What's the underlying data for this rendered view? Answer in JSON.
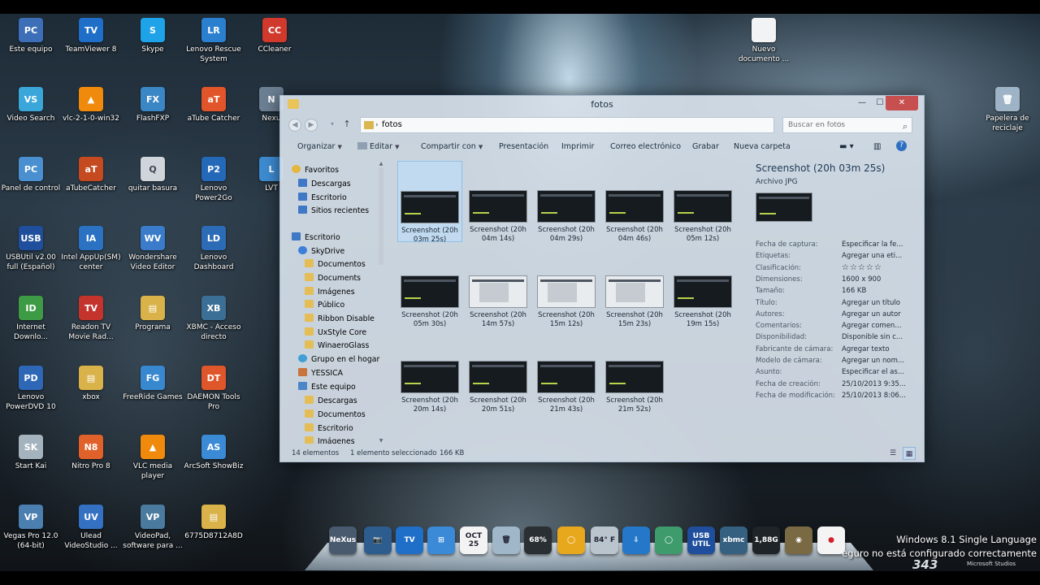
{
  "desktop": {
    "icons": [
      {
        "label": "Este equipo",
        "glyph": "PC",
        "color": "#3d6fb8"
      },
      {
        "label": "TeamViewer 8",
        "glyph": "TV",
        "color": "#1f6fc9"
      },
      {
        "label": "Skype",
        "glyph": "S",
        "color": "#1fa3e8"
      },
      {
        "label": "Lenovo Rescue System",
        "glyph": "LR",
        "color": "#2a7fcf"
      },
      {
        "label": "CCleaner",
        "glyph": "CC",
        "color": "#d0392b"
      },
      {
        "label": "Video Search",
        "glyph": "VS",
        "color": "#3aa6d9"
      },
      {
        "label": "vlc-2-1-0-win32",
        "glyph": "▲",
        "color": "#f08a0c"
      },
      {
        "label": "FlashFXP",
        "glyph": "FX",
        "color": "#3b86c4"
      },
      {
        "label": "aTube Catcher",
        "glyph": "aT",
        "color": "#e2552a"
      },
      {
        "label": "Nexu",
        "glyph": "N",
        "color": "#6c7f93"
      },
      {
        "label": "Panel de control",
        "glyph": "PC",
        "color": "#4a8fd0"
      },
      {
        "label": "aTubeCatcher",
        "glyph": "aT",
        "color": "#c54a1f"
      },
      {
        "label": "quitar basura",
        "glyph": "Q",
        "color": "#cfd5da"
      },
      {
        "label": "Lenovo Power2Go",
        "glyph": "P2",
        "color": "#2468b8"
      },
      {
        "label": "LVT",
        "glyph": "L",
        "color": "#3d8bd0"
      },
      {
        "label": "USBUtil v2.00 full (Español)",
        "glyph": "USB",
        "color": "#1f4f9c"
      },
      {
        "label": "Intel AppUp(SM) center",
        "glyph": "IA",
        "color": "#2b72c2"
      },
      {
        "label": "Wondershare Video Editor",
        "glyph": "WV",
        "color": "#3a7cc9"
      },
      {
        "label": "Lenovo Dashboard",
        "glyph": "LD",
        "color": "#2c6cb6"
      },
      {
        "label": "Internet Downlo...",
        "glyph": "ID",
        "color": "#3e9b45"
      },
      {
        "label": "Readon TV Movie Rad...",
        "glyph": "TV",
        "color": "#c4342c"
      },
      {
        "label": "Programa",
        "glyph": "▤",
        "color": "#d9b24a"
      },
      {
        "label": "XBMC - Acceso directo",
        "glyph": "XB",
        "color": "#3c6f95"
      },
      {
        "label": "Lenovo PowerDVD 10",
        "glyph": "PD",
        "color": "#2d67b6"
      },
      {
        "label": "xbox",
        "glyph": "▤",
        "color": "#d9b24a"
      },
      {
        "label": "FreeRide Games",
        "glyph": "FG",
        "color": "#3888d0"
      },
      {
        "label": "DAEMON Tools Pro",
        "glyph": "DT",
        "color": "#e0562b"
      },
      {
        "label": "Start Kai",
        "glyph": "SK",
        "color": "#a5b3bf"
      },
      {
        "label": "Nitro Pro 8",
        "glyph": "N8",
        "color": "#e0612a"
      },
      {
        "label": "VLC media player",
        "glyph": "▲",
        "color": "#f08a0c"
      },
      {
        "label": "ArcSoft ShowBiz",
        "glyph": "AS",
        "color": "#3a8ad5"
      },
      {
        "label": "Vegas Pro 12.0 (64-bit)",
        "glyph": "VP",
        "color": "#4a7fb0"
      },
      {
        "label": "Ulead VideoStudio ...",
        "glyph": "UV",
        "color": "#3471c2"
      },
      {
        "label": "VideoPad, software para ...",
        "glyph": "VP",
        "color": "#4b7a9f"
      },
      {
        "label": "6775D8712A8D",
        "glyph": "▤",
        "color": "#d9b24a"
      },
      {
        "label": "Nuevo documento ...",
        "glyph": "",
        "color": "#f1f3f5"
      },
      {
        "label": "Papelera de reciclaje",
        "glyph": "🗑",
        "color": "#9eb4c6"
      }
    ]
  },
  "window": {
    "title": "fotos",
    "address": "fotos",
    "search_placeholder": "Buscar en fotos",
    "toolbar": {
      "organizar": "Organizar",
      "editar": "Editar",
      "compartir": "Compartir con",
      "presentacion": "Presentación",
      "imprimir": "Imprimir",
      "correo": "Correo electrónico",
      "grabar": "Grabar",
      "nueva_carpeta": "Nueva carpeta"
    },
    "nav": [
      {
        "label": "Favoritos",
        "icon": "star",
        "indent": 0
      },
      {
        "label": "Descargas",
        "icon": "blue",
        "indent": 1
      },
      {
        "label": "Escritorio",
        "icon": "blue",
        "indent": 1
      },
      {
        "label": "Sitios recientes",
        "icon": "blue",
        "indent": 1
      },
      {
        "label": "Escritorio",
        "icon": "blue",
        "indent": 0
      },
      {
        "label": "SkyDrive",
        "icon": "cloud",
        "indent": 1
      },
      {
        "label": "Documentos",
        "icon": "fold",
        "indent": 2
      },
      {
        "label": "Documents",
        "icon": "fold",
        "indent": 2
      },
      {
        "label": "Imágenes",
        "icon": "fold",
        "indent": 2
      },
      {
        "label": "Público",
        "icon": "fold",
        "indent": 2
      },
      {
        "label": "Ribbon Disable",
        "icon": "fold",
        "indent": 2
      },
      {
        "label": "UxStyle Core",
        "icon": "fold",
        "indent": 2
      },
      {
        "label": "WinaeroGlass",
        "icon": "fold",
        "indent": 2
      },
      {
        "label": "Grupo en el hogar",
        "icon": "group",
        "indent": 1
      },
      {
        "label": "YESSICA",
        "icon": "user",
        "indent": 1
      },
      {
        "label": "Este equipo",
        "icon": "pc",
        "indent": 1
      },
      {
        "label": "Descargas",
        "icon": "fold",
        "indent": 2
      },
      {
        "label": "Documentos",
        "icon": "fold",
        "indent": 2
      },
      {
        "label": "Escritorio",
        "icon": "fold",
        "indent": 2
      },
      {
        "label": "Imágenes",
        "icon": "fold",
        "indent": 2
      }
    ],
    "files": [
      {
        "name": "Screenshot (20h 03m 25s)",
        "light": false,
        "selected": true
      },
      {
        "name": "Screenshot (20h 04m 14s)",
        "light": false
      },
      {
        "name": "Screenshot (20h 04m 29s)",
        "light": false
      },
      {
        "name": "Screenshot (20h 04m 46s)",
        "light": false
      },
      {
        "name": "Screenshot (20h 05m 12s)",
        "light": false
      },
      {
        "name": "Screenshot (20h 05m 30s)",
        "light": false
      },
      {
        "name": "Screenshot (20h 14m 57s)",
        "light": true
      },
      {
        "name": "Screenshot (20h 15m 12s)",
        "light": true
      },
      {
        "name": "Screenshot (20h 15m 23s)",
        "light": true
      },
      {
        "name": "Screenshot (20h 19m 15s)",
        "light": false
      },
      {
        "name": "Screenshot (20h 20m 14s)",
        "light": false
      },
      {
        "name": "Screenshot (20h 20m 51s)",
        "light": false
      },
      {
        "name": "Screenshot (20h 21m 43s)",
        "light": false
      },
      {
        "name": "Screenshot (20h 21m 52s)",
        "light": false
      }
    ],
    "details": {
      "name": "Screenshot (20h 03m 25s)",
      "type": "Archivo JPG",
      "props": [
        {
          "k": "Fecha de captura:",
          "v": "Especificar la fe..."
        },
        {
          "k": "Etiquetas:",
          "v": "Agregar una eti..."
        },
        {
          "k": "Clasificación:",
          "v": "☆☆☆☆☆"
        },
        {
          "k": "Dimensiones:",
          "v": "1600 x 900"
        },
        {
          "k": "Tamaño:",
          "v": "166 KB"
        },
        {
          "k": "Título:",
          "v": "Agregar un título"
        },
        {
          "k": "Autores:",
          "v": "Agregar un autor"
        },
        {
          "k": "Comentarios:",
          "v": "Agregar comen..."
        },
        {
          "k": "Disponibilidad:",
          "v": "Disponible sin c..."
        },
        {
          "k": "Fabricante de cámara:",
          "v": "Agregar texto"
        },
        {
          "k": "Modelo de cámara:",
          "v": "Agregar un nom..."
        },
        {
          "k": "Asunto:",
          "v": "Especificar el as..."
        },
        {
          "k": "Fecha de creación:",
          "v": "25/10/2013 9:35..."
        },
        {
          "k": "Fecha de modificación:",
          "v": "25/10/2013 8:06..."
        }
      ]
    },
    "status": {
      "count": "14 elementos",
      "selected": "1 elemento seleccionado",
      "size": "166 KB"
    }
  },
  "dock": {
    "items": [
      {
        "name": "nexus",
        "text": "NeXus",
        "color": "#4a5a6e"
      },
      {
        "name": "camera",
        "text": "📷",
        "color": "#2d5c8f"
      },
      {
        "name": "teamviewer",
        "text": "TV",
        "color": "#1f6fc9"
      },
      {
        "name": "windows",
        "text": "⊞",
        "color": "#3b8ad8"
      },
      {
        "name": "calendar",
        "text": "OCT 25",
        "color": "#f3f3f3"
      },
      {
        "name": "recycle",
        "text": "🗑",
        "color": "#9fb7c8"
      },
      {
        "name": "meter",
        "text": "68%",
        "color": "#2a2f33"
      },
      {
        "name": "circle",
        "text": "◯",
        "color": "#e8a81e"
      },
      {
        "name": "weather",
        "text": "84° F",
        "color": "#b9c4cc"
      },
      {
        "name": "download",
        "text": "⇩",
        "color": "#2578c9"
      },
      {
        "name": "ring",
        "text": "◯",
        "color": "#3e9b6b"
      },
      {
        "name": "usb",
        "text": "USB UTIL",
        "color": "#1f4f9c"
      },
      {
        "name": "xbmc",
        "text": "xbmc",
        "color": "#36607f"
      },
      {
        "name": "meter-mem",
        "text": "1,88G",
        "color": "#1e2428"
      },
      {
        "name": "globe",
        "text": "◉",
        "color": "#7a6a43"
      },
      {
        "name": "japan",
        "text": "●",
        "color": "#f4f4f4"
      }
    ],
    "calendar_month": "OCT",
    "calendar_day": "25",
    "meter_pct": "68%",
    "weather": "84° F",
    "mem": "1,88G"
  },
  "os": {
    "edition": "Windows 8.1 Single Language",
    "notice": "eguro no está configurado correctamente",
    "brand": "343",
    "brand_small": "Microsoft Studios"
  }
}
